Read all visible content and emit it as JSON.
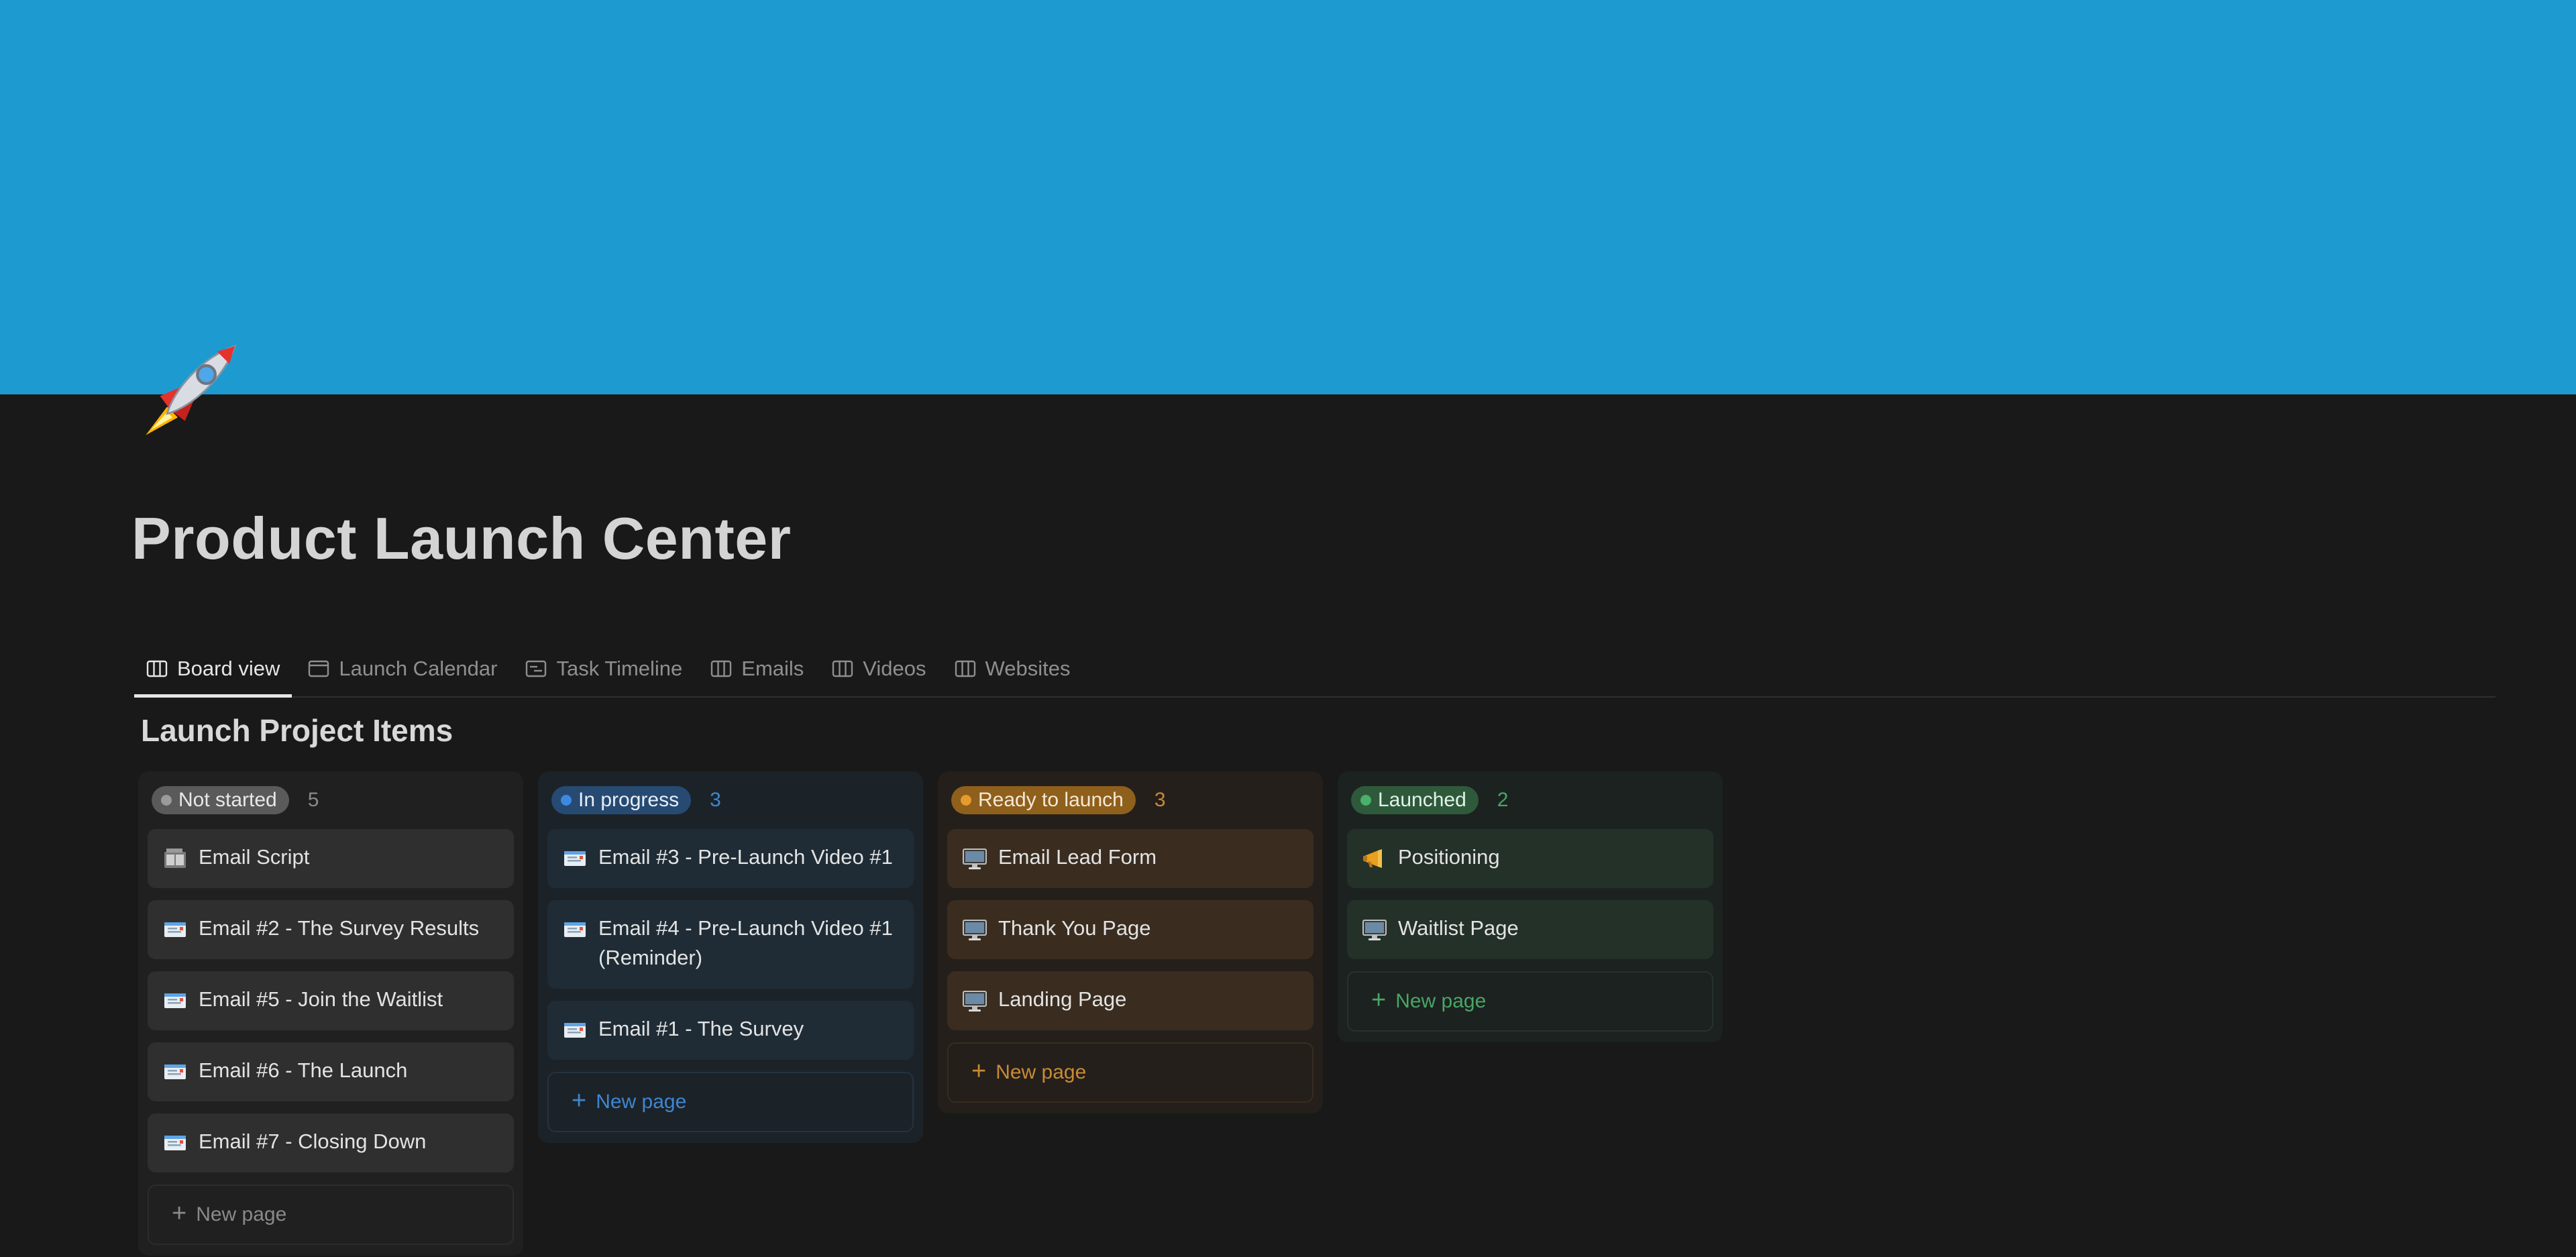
{
  "page": {
    "title": "Product Launch Center",
    "cover_color": "#1d9bd1",
    "icon": "rocket-icon"
  },
  "tabs": [
    {
      "label": "Board view",
      "icon": "board-icon",
      "active": true
    },
    {
      "label": "Launch Calendar",
      "icon": "calendar-icon",
      "active": false
    },
    {
      "label": "Task Timeline",
      "icon": "timeline-icon",
      "active": false
    },
    {
      "label": "Emails",
      "icon": "board-icon",
      "active": false
    },
    {
      "label": "Videos",
      "icon": "board-icon",
      "active": false
    },
    {
      "label": "Websites",
      "icon": "board-icon",
      "active": false
    }
  ],
  "section_title": "Launch Project Items",
  "board": {
    "new_page_label": "New page",
    "columns": [
      {
        "status": "Not started",
        "count": "5",
        "color": "#9b9b9b",
        "cards": [
          {
            "title": "Email Script",
            "icon": "film-frames-icon"
          },
          {
            "title": "Email #2 - The Survey Results",
            "icon": "email-icon"
          },
          {
            "title": "Email #5 - Join the Waitlist",
            "icon": "email-icon"
          },
          {
            "title": "Email #6 - The Launch",
            "icon": "email-icon"
          },
          {
            "title": "Email #7 - Closing Down",
            "icon": "email-icon"
          }
        ]
      },
      {
        "status": "In progress",
        "count": "3",
        "color": "#3c8ae0",
        "cards": [
          {
            "title": "Email #3 - Pre-Launch Video #1",
            "icon": "email-icon"
          },
          {
            "title": "Email #4 - Pre-Launch Video #1 (Reminder)",
            "icon": "email-icon"
          },
          {
            "title": "Email #1 - The Survey",
            "icon": "email-icon"
          }
        ]
      },
      {
        "status": "Ready to launch",
        "count": "3",
        "color": "#e69b2e",
        "cards": [
          {
            "title": "Email Lead Form",
            "icon": "desktop-computer-icon"
          },
          {
            "title": "Thank You Page",
            "icon": "desktop-computer-icon"
          },
          {
            "title": "Landing Page",
            "icon": "desktop-computer-icon"
          }
        ]
      },
      {
        "status": "Launched",
        "count": "2",
        "color": "#4ab06b",
        "cards": [
          {
            "title": "Positioning",
            "icon": "megaphone-icon"
          },
          {
            "title": "Waitlist Page",
            "icon": "desktop-computer-icon"
          }
        ]
      }
    ]
  }
}
